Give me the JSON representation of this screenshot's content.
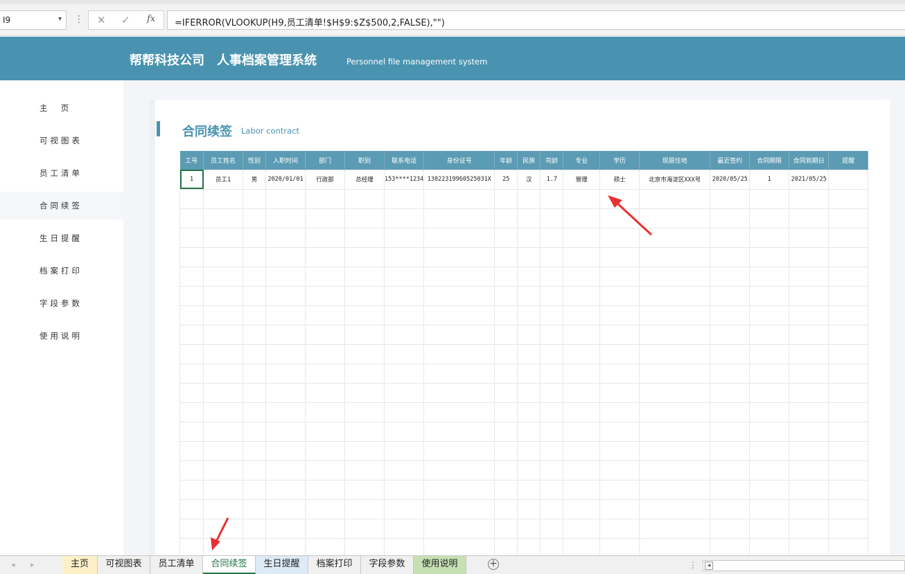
{
  "formula_bar": {
    "name_box": "I9",
    "dropdown_glyph": "▾",
    "cancel_glyph": "✕",
    "enter_glyph": "✓",
    "fx_glyph": "fx",
    "formula": "=IFERROR(VLOOKUP(H9,员工清单!$H$9:$Z$500,2,FALSE),\"\")"
  },
  "header": {
    "company": "帮帮科技公司",
    "system": "人事档案管理系统",
    "subtitle": "Personnel file management system",
    "bg_color": "#4a93b0"
  },
  "sidebar": {
    "items": [
      {
        "label": "主  页"
      },
      {
        "label": "可视图表"
      },
      {
        "label": "员工清单"
      },
      {
        "label": "合同续签"
      },
      {
        "label": "生日提醒"
      },
      {
        "label": "档案打印"
      },
      {
        "label": "字段参数"
      },
      {
        "label": "使用说明"
      }
    ],
    "active_index": 3
  },
  "page": {
    "title": "合同续签",
    "subtitle": "Labor contract"
  },
  "table": {
    "headers": [
      "工号",
      "员工姓名",
      "性别",
      "入职时间",
      "部门",
      "职别",
      "联系电话",
      "身份证号",
      "年龄",
      "民族",
      "司龄",
      "专业",
      "学历",
      "现居住地",
      "最近签约",
      "合同期限",
      "合同到期日",
      "提醒"
    ],
    "rows": [
      [
        "1",
        "员工1",
        "男",
        "2020/01/01",
        "行政部",
        "总经理",
        "153****1234",
        "130223199605250­31X",
        "25",
        "汉",
        "1.7",
        "管理",
        "硕士",
        "北京市海淀区XXX号",
        "2020/05/25",
        "1",
        "2021/05/25",
        ""
      ]
    ],
    "empty_rows": 19
  },
  "sheet_tabs": {
    "tabs": [
      {
        "label": "主页",
        "color": "#fdf0c8"
      },
      {
        "label": "可视图表",
        "color": ""
      },
      {
        "label": "员工清单",
        "color": ""
      },
      {
        "label": "合同续签",
        "color": ""
      },
      {
        "label": "生日提醒",
        "color": "#ddebf7"
      },
      {
        "label": "档案打印",
        "color": ""
      },
      {
        "label": "字段参数",
        "color": ""
      },
      {
        "label": "使用说明",
        "color": "#c6e0b4"
      }
    ],
    "active_index": 3,
    "add_glyph": "+",
    "more_glyph": "⋮",
    "scroll_left_glyph": "◂"
  }
}
